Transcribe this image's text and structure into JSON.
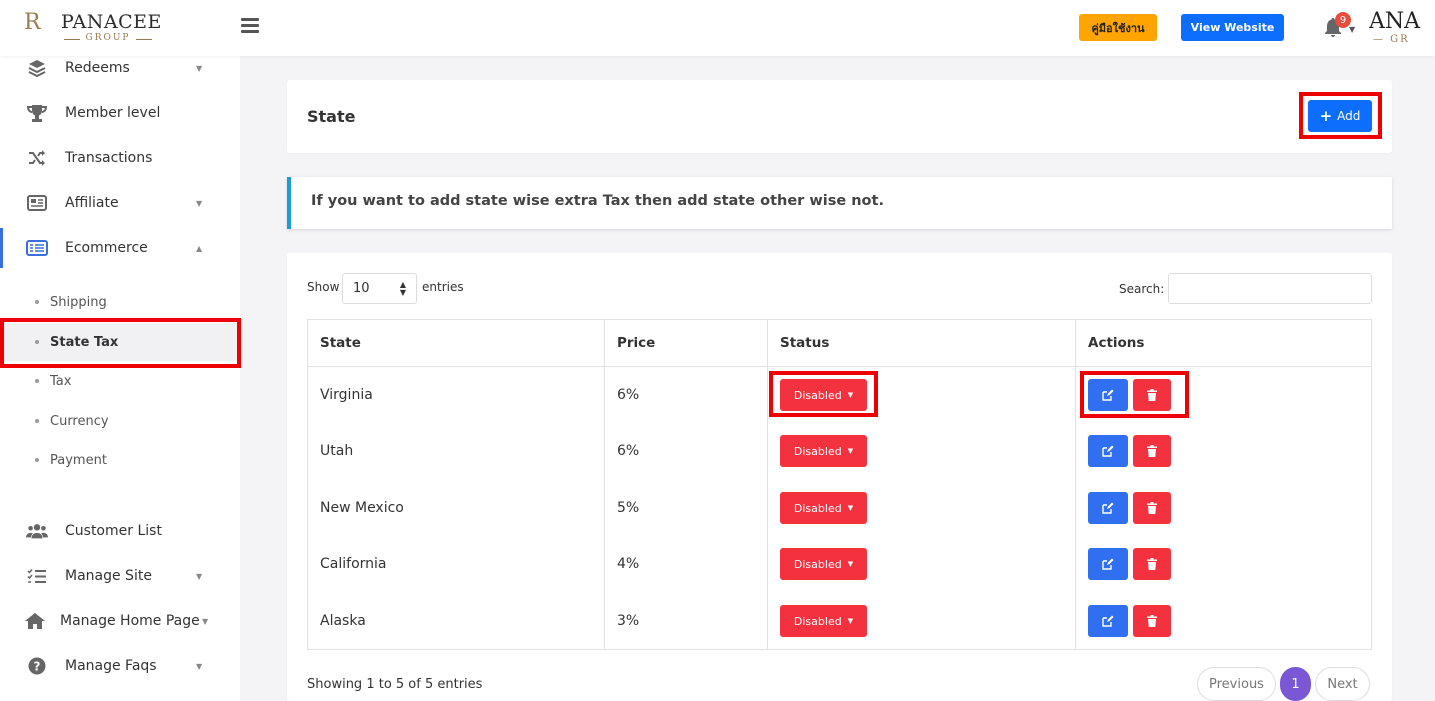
{
  "header": {
    "logo_monogram": "R",
    "logo_brand": "PANACEE",
    "logo_group": "GROUP",
    "manual_label": "คู่มือใช้งาน",
    "view_website_label": "View Website",
    "notification_count": "9",
    "right_logo_text": "ANA",
    "right_logo_sub": "— GR"
  },
  "sidebar": {
    "items": [
      {
        "label": "Redeems"
      },
      {
        "label": "Member level"
      },
      {
        "label": "Transactions"
      },
      {
        "label": "Affiliate"
      },
      {
        "label": "Ecommerce"
      },
      {
        "label": "Customer List"
      },
      {
        "label": "Manage Site"
      },
      {
        "label": "Manage Home Page"
      },
      {
        "label": "Manage Faqs"
      }
    ],
    "subitems": [
      {
        "label": "Shipping"
      },
      {
        "label": "State Tax"
      },
      {
        "label": "Tax"
      },
      {
        "label": "Currency"
      },
      {
        "label": "Payment"
      }
    ]
  },
  "page": {
    "title": "State",
    "add_label": "Add",
    "notice": "If you want to add state wise extra Tax then add state other wise not."
  },
  "table_controls": {
    "show_label": "Show",
    "page_length": "10",
    "entries_label": "entries",
    "search_label": "Search:",
    "search_value": ""
  },
  "table": {
    "headers": [
      "State",
      "Price",
      "Status",
      "Actions"
    ],
    "rows": [
      {
        "state": "Virginia",
        "price": "6%",
        "status": "Disabled"
      },
      {
        "state": "Utah",
        "price": "6%",
        "status": "Disabled"
      },
      {
        "state": "New Mexico",
        "price": "5%",
        "status": "Disabled"
      },
      {
        "state": "California",
        "price": "4%",
        "status": "Disabled"
      },
      {
        "state": "Alaska",
        "price": "3%",
        "status": "Disabled"
      }
    ]
  },
  "footer": {
    "info": "Showing 1 to 5 of 5 entries",
    "previous_label": "Previous",
    "current_page": "1",
    "next_label": "Next"
  },
  "colors": {
    "primary": "#0d6efd",
    "danger": "#f4323f",
    "warning": "#ffa400",
    "pagination_active": "#7957d5",
    "highlight_box": "#ee0000"
  }
}
